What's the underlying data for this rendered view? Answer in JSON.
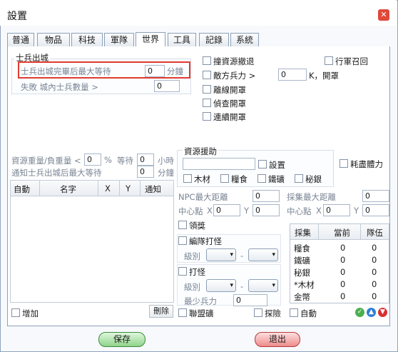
{
  "window": {
    "title": "設置",
    "close_icon": "close-icon"
  },
  "tabs": [
    "普通",
    "物品",
    "科技",
    "軍隊",
    "世界",
    "工具",
    "記錄",
    "系統"
  ],
  "active_tab": "世界",
  "troops": {
    "header": "士兵出城",
    "wait_label": "士兵出城完畢后最大等待",
    "wait_value": "0",
    "wait_unit": "分鐘",
    "fail_label": "失敗 城內士兵數量 >",
    "fail_value": "0"
  },
  "options": {
    "retreat": "撞資源撤退",
    "enemy_force": "敵方兵力 >",
    "enemy_value": "0",
    "enemy_suffix": "K，開罩",
    "offline": "離線開罩",
    "scout": "偵查開罩",
    "consecutive": "連續開罩",
    "recall": "行軍召回"
  },
  "resource_weight": {
    "label": "資源重量/負重量 <",
    "value": "0",
    "percent": "%",
    "wait_label": "等待",
    "wait_value": "0",
    "wait_unit": "小時"
  },
  "notify": {
    "label": "通知士兵出城后最大等待",
    "value": "0",
    "unit": "分鐘"
  },
  "list_table": {
    "columns": [
      "自動",
      "名字",
      "X",
      "Y",
      "通知"
    ]
  },
  "aid": {
    "header": "資源援助",
    "input_value": "",
    "setting": "設置",
    "wood": "木材",
    "food": "糧食",
    "iron": "鐵礦",
    "silver": "秘銀",
    "exhaust": "耗盡體力"
  },
  "npc": {
    "max_label": "NPC最大距離",
    "max_value": "0",
    "center_label": "中心點",
    "x_label": "X",
    "x_value": "0",
    "y_label": "Y",
    "y_value": "0"
  },
  "gather": {
    "max_label": "採集最大距離",
    "max_value": "0",
    "center_label": "中心點",
    "x_label": "X",
    "x_value": "0",
    "y_label": "Y",
    "y_value": "0"
  },
  "reward": "領獎",
  "team_monster": {
    "label": "編隊打怪",
    "level_label": "級別",
    "dash": "-"
  },
  "monster": {
    "label": "打怪",
    "level_label": "級別",
    "dash": "-",
    "min_force_label": "最少兵力",
    "min_force_value": "0"
  },
  "gather_table": {
    "columns": [
      "採集",
      "當前",
      "隊伍"
    ],
    "rows": [
      [
        "糧食",
        "0",
        "0"
      ],
      [
        "鐵礦",
        "0",
        "0"
      ],
      [
        "秘銀",
        "0",
        "0"
      ],
      [
        "*木材",
        "0",
        "0"
      ],
      [
        "金幣",
        "0",
        "0"
      ]
    ]
  },
  "bottom": {
    "add": "增加",
    "delete": "刪除",
    "alliance_mine": "聯盟礦",
    "explore": "探險",
    "auto": "自動"
  },
  "actions": {
    "save": "保存",
    "quit": "退出"
  },
  "colors": {
    "close": "#e0483a",
    "highlight": "#e03b30",
    "save": "#8fd38b",
    "quit": "#ee8b8b",
    "check": "#4caf50",
    "up": "#2f7fd6",
    "down": "#d93030"
  }
}
